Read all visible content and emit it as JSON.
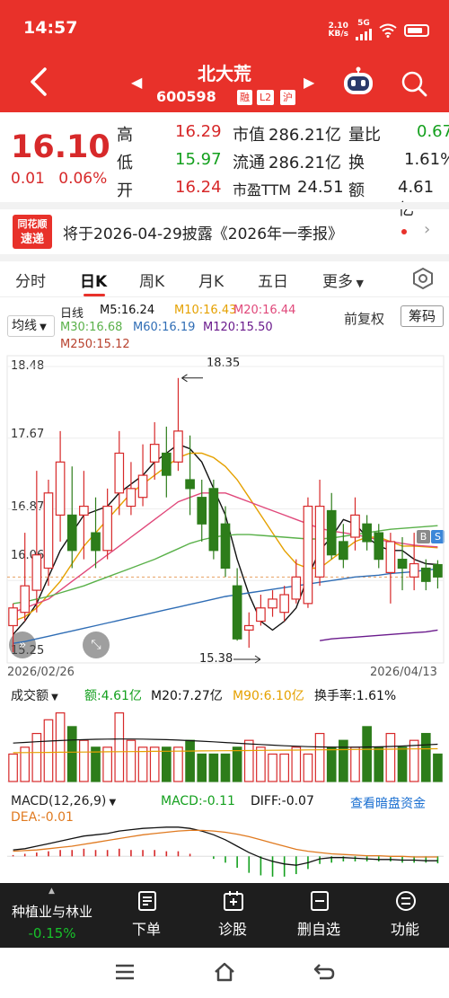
{
  "status": {
    "time": "14:57",
    "net_speed": "2.10",
    "net_unit": "KB/s",
    "net_type": "5G"
  },
  "header": {
    "stock_name": "北大荒",
    "stock_code": "600598",
    "badges": [
      "融",
      "L2",
      "沪"
    ]
  },
  "quote": {
    "price": "16.10",
    "change": "0.01",
    "change_pct": "0.06%",
    "high_label": "高",
    "high": "16.29",
    "low_label": "低",
    "low": "15.97",
    "open_label": "开",
    "open": "16.24",
    "mktcap_label": "市值",
    "mktcap": "286.21亿",
    "float_label": "流通",
    "float": "286.21亿",
    "pe_label": "市盈TTM",
    "pe": "24.51",
    "volratio_label": "量比",
    "volratio": "0.67",
    "turnover_label": "换",
    "turnover": "1.61%",
    "amount_label": "额",
    "amount": "4.61亿"
  },
  "news": {
    "logo_line1": "同花顺",
    "logo_line2": "速递",
    "text": "将于2026-04-29披露《2026年一季报》"
  },
  "tabs": [
    "分时",
    "日K",
    "周K",
    "月K",
    "五日",
    "更多"
  ],
  "ma": {
    "select": "均线",
    "period": "日线",
    "m5": "M5:16.24",
    "m10": "M10:16.43",
    "m20": "M20:16.44",
    "m30": "M30:16.68",
    "m60": "M60:16.19",
    "m120": "M120:15.50",
    "m250": "M250:15.12",
    "adjust": "前复权",
    "chips": "筹码",
    "colors": {
      "m5": "#111111",
      "m10": "#e5a100",
      "m20": "#e0487a",
      "m30": "#5ab14a",
      "m60": "#2f6db5",
      "m120": "#6a1a8c",
      "m250": "#b8422e"
    }
  },
  "chart_data": {
    "type": "candlestick",
    "price_axis": [
      "18.48",
      "17.67",
      "16.87",
      "16.06",
      "15.25"
    ],
    "dates": [
      "2026/02/26",
      "2026/04/13"
    ],
    "annotations": {
      "high": "18.35",
      "low": "15.38"
    },
    "candles": [
      [
        15.55,
        15.75,
        15.25,
        15.8
      ],
      [
        15.7,
        16.0,
        15.6,
        16.6
      ],
      [
        15.95,
        16.35,
        15.7,
        17.3
      ],
      [
        16.2,
        17.05,
        16.0,
        17.2
      ],
      [
        16.8,
        17.4,
        16.5,
        17.75
      ],
      [
        16.8,
        16.4,
        16.2,
        17.35
      ],
      [
        16.8,
        16.9,
        16.3,
        17.3
      ],
      [
        16.6,
        16.4,
        16.2,
        17.0
      ],
      [
        16.4,
        16.9,
        16.3,
        17.1
      ],
      [
        17.05,
        17.5,
        16.8,
        17.75
      ],
      [
        16.9,
        17.1,
        16.8,
        17.4
      ],
      [
        17.0,
        17.25,
        16.9,
        17.6
      ],
      [
        17.4,
        17.6,
        17.2,
        17.85
      ],
      [
        17.5,
        17.25,
        17.0,
        17.8
      ],
      [
        17.4,
        17.75,
        17.3,
        18.35
      ],
      [
        17.2,
        17.1,
        16.8,
        17.7
      ],
      [
        17.0,
        16.7,
        16.5,
        17.2
      ],
      [
        17.1,
        16.4,
        16.3,
        17.2
      ],
      [
        16.7,
        16.2,
        16.1,
        16.9
      ],
      [
        16.0,
        15.4,
        15.38,
        16.2
      ],
      [
        15.5,
        15.55,
        15.3,
        15.7
      ],
      [
        15.6,
        15.75,
        15.55,
        15.9
      ],
      [
        15.75,
        15.85,
        15.65,
        15.95
      ],
      [
        15.7,
        15.9,
        15.6,
        16.0
      ],
      [
        15.85,
        16.1,
        15.8,
        16.3
      ],
      [
        15.8,
        16.9,
        15.75,
        17.0
      ],
      [
        16.1,
        16.9,
        16.0,
        17.2
      ],
      [
        16.85,
        16.35,
        16.3,
        17.05
      ],
      [
        16.5,
        16.3,
        16.2,
        16.7
      ],
      [
        16.55,
        16.8,
        16.4,
        17.0
      ],
      [
        16.7,
        16.5,
        16.4,
        16.8
      ],
      [
        16.6,
        16.3,
        16.2,
        16.7
      ],
      [
        16.15,
        16.5,
        15.8,
        16.6
      ],
      [
        16.3,
        16.2,
        15.95,
        16.55
      ],
      [
        16.1,
        16.25,
        15.95,
        16.6
      ],
      [
        16.2,
        16.05,
        15.95,
        16.3
      ],
      [
        16.24,
        16.1,
        15.97,
        16.29
      ]
    ],
    "ma_series": [
      {
        "name": "M5",
        "values": [
          15.45,
          15.6,
          15.8,
          16.1,
          16.4,
          16.6,
          16.8,
          16.85,
          16.9,
          17.05,
          17.15,
          17.25,
          17.4,
          17.5,
          17.6,
          17.55,
          17.4,
          17.1,
          16.8,
          16.3,
          15.9,
          15.6,
          15.5,
          15.6,
          15.75,
          16.1,
          16.4,
          16.55,
          16.75,
          16.7,
          16.55,
          16.45,
          16.4,
          16.4,
          16.3,
          16.25,
          16.24
        ]
      },
      {
        "name": "M10",
        "values": [
          15.6,
          15.65,
          15.75,
          15.9,
          16.05,
          16.25,
          16.45,
          16.6,
          16.75,
          16.9,
          17.05,
          17.15,
          17.25,
          17.35,
          17.45,
          17.5,
          17.5,
          17.45,
          17.35,
          17.2,
          17.0,
          16.8,
          16.6,
          16.4,
          16.25,
          16.2,
          16.2,
          16.3,
          16.4,
          16.5,
          16.55,
          16.55,
          16.5,
          16.45,
          16.45,
          16.44,
          16.43
        ]
      },
      {
        "name": "M20",
        "values": [
          15.7,
          15.75,
          15.8,
          15.85,
          15.95,
          16.05,
          16.15,
          16.25,
          16.35,
          16.45,
          16.55,
          16.65,
          16.75,
          16.85,
          16.95,
          17.0,
          17.05,
          17.05,
          17.05,
          17.0,
          16.95,
          16.9,
          16.85,
          16.8,
          16.75,
          16.7,
          16.65,
          16.62,
          16.6,
          16.58,
          16.55,
          16.52,
          16.5,
          16.48,
          16.46,
          16.45,
          16.44
        ]
      },
      {
        "name": "M30",
        "values": [
          15.8,
          15.82,
          15.85,
          15.88,
          15.92,
          15.96,
          16.0,
          16.05,
          16.1,
          16.15,
          16.2,
          16.25,
          16.3,
          16.36,
          16.42,
          16.48,
          16.52,
          16.55,
          16.57,
          16.58,
          16.58,
          16.57,
          16.56,
          16.55,
          16.54,
          16.53,
          16.53,
          16.54,
          16.56,
          16.58,
          16.6,
          16.62,
          16.64,
          16.65,
          16.66,
          16.67,
          16.68
        ]
      },
      {
        "name": "M60",
        "values": [
          15.35,
          15.37,
          15.4,
          15.43,
          15.46,
          15.49,
          15.52,
          15.55,
          15.58,
          15.61,
          15.64,
          15.67,
          15.7,
          15.73,
          15.76,
          15.79,
          15.82,
          15.85,
          15.88,
          15.9,
          15.92,
          15.94,
          15.96,
          15.98,
          16.0,
          16.02,
          16.04,
          16.06,
          16.08,
          16.1,
          16.11,
          16.12,
          16.14,
          16.15,
          16.16,
          16.18,
          16.19
        ]
      },
      {
        "name": "M120",
        "values": [
          null,
          null,
          null,
          null,
          null,
          null,
          null,
          null,
          null,
          null,
          null,
          null,
          null,
          null,
          null,
          null,
          null,
          null,
          null,
          null,
          null,
          null,
          null,
          null,
          null,
          null,
          15.38,
          15.4,
          15.41,
          15.42,
          15.43,
          15.44,
          15.45,
          15.46,
          15.47,
          15.48,
          15.5
        ]
      }
    ],
    "volume": {
      "label": "成交额",
      "amount": "额:4.61亿",
      "m20": "M20:7.27亿",
      "m90": "M90:6.10亿",
      "turnover": "换手率:1.61%",
      "bars": [
        4,
        5,
        7,
        9,
        10,
        8,
        6,
        5,
        5,
        10,
        6,
        5,
        5,
        5,
        5,
        6,
        4,
        4,
        4,
        5,
        6,
        5,
        4,
        4,
        5,
        4,
        7,
        5,
        6,
        5,
        8,
        5,
        7,
        5,
        6,
        7,
        4
      ]
    },
    "macd": {
      "label": "MACD(12,26,9)",
      "macd": "MACD:-0.11",
      "diff": "DIFF:-0.07",
      "dea": "DEA:-0.01",
      "hist": [
        0.02,
        0.04,
        0.06,
        0.08,
        0.1,
        0.1,
        0.12,
        0.1,
        0.1,
        0.12,
        0.1,
        0.1,
        0.1,
        0.08,
        0.08,
        0.04,
        0.0,
        -0.04,
        -0.1,
        -0.18,
        -0.26,
        -0.3,
        -0.32,
        -0.32,
        -0.28,
        -0.2,
        -0.12,
        -0.1,
        -0.08,
        -0.08,
        -0.08,
        -0.08,
        -0.08,
        -0.1,
        -0.1,
        -0.1,
        -0.11
      ],
      "diff_series": [
        0.1,
        0.12,
        0.16,
        0.2,
        0.24,
        0.28,
        0.32,
        0.34,
        0.36,
        0.4,
        0.42,
        0.44,
        0.45,
        0.46,
        0.46,
        0.44,
        0.4,
        0.34,
        0.26,
        0.16,
        0.06,
        -0.02,
        -0.08,
        -0.12,
        -0.14,
        -0.1,
        -0.04,
        -0.02,
        -0.02,
        -0.03,
        -0.04,
        -0.05,
        -0.05,
        -0.06,
        -0.06,
        -0.07,
        -0.07
      ],
      "dea_series": [
        0.08,
        0.09,
        0.1,
        0.12,
        0.14,
        0.16,
        0.19,
        0.22,
        0.25,
        0.28,
        0.31,
        0.34,
        0.36,
        0.38,
        0.4,
        0.41,
        0.41,
        0.4,
        0.38,
        0.35,
        0.31,
        0.26,
        0.21,
        0.16,
        0.11,
        0.08,
        0.06,
        0.04,
        0.03,
        0.02,
        0.01,
        0.01,
        0.0,
        0.0,
        -0.01,
        -0.01,
        -0.01
      ]
    },
    "dark_pool_link": "查看暗盘资金"
  },
  "toolbar": {
    "sector_name": "种植业与林业",
    "sector_pct": "-0.15%",
    "buttons": [
      "下单",
      "诊股",
      "删自选",
      "功能"
    ]
  },
  "colors": {
    "red": "#e8312a",
    "up": "#d7292a",
    "down": "#14a01e",
    "down_candle": "#2d7d1a"
  }
}
